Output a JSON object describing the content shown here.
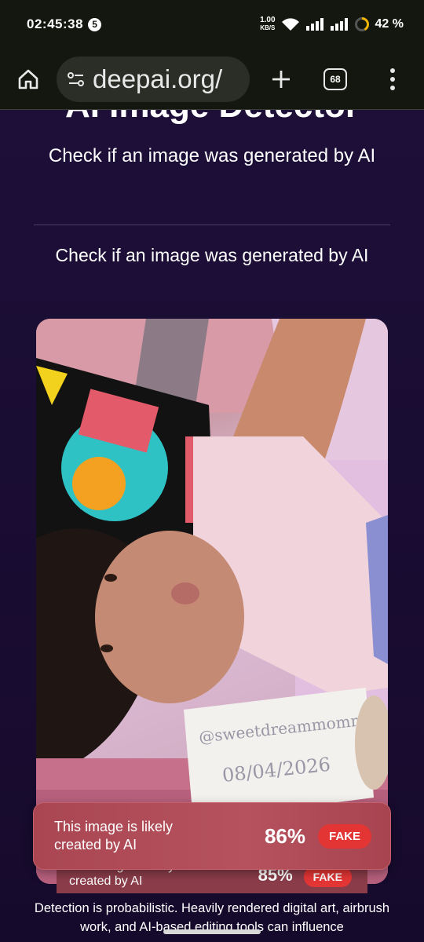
{
  "status_bar": {
    "time": "02:45:38",
    "notification_count": "5",
    "net_speed_value": "1.00",
    "net_speed_unit": "KB/S",
    "battery": "42 %"
  },
  "browser": {
    "url": "deepai.org/",
    "tab_count": "68"
  },
  "page": {
    "heading": "AI Image Detector",
    "subtitle": "Check if an image was generated by AI",
    "subtitle_2": "Check if an image was generated by AI",
    "photo_note_handle": "@sweetdreammommy",
    "photo_note_date": "08/04/2026"
  },
  "result": {
    "text": "This image is likely created by AI",
    "percent": "86%",
    "label": "FAKE",
    "progress_fraction": 0.86
  },
  "result_2": {
    "text": "This image is likely created by AI",
    "percent": "85%",
    "label": "FAKE"
  },
  "disclaimer": "Detection is probabilistic. Heavily rendered digital art, airbrush work, and AI-based editing tools can influence",
  "colors": {
    "page_bg": "#150b2e",
    "result_bg": "#b04c58",
    "fake_badge": "#e43535"
  }
}
